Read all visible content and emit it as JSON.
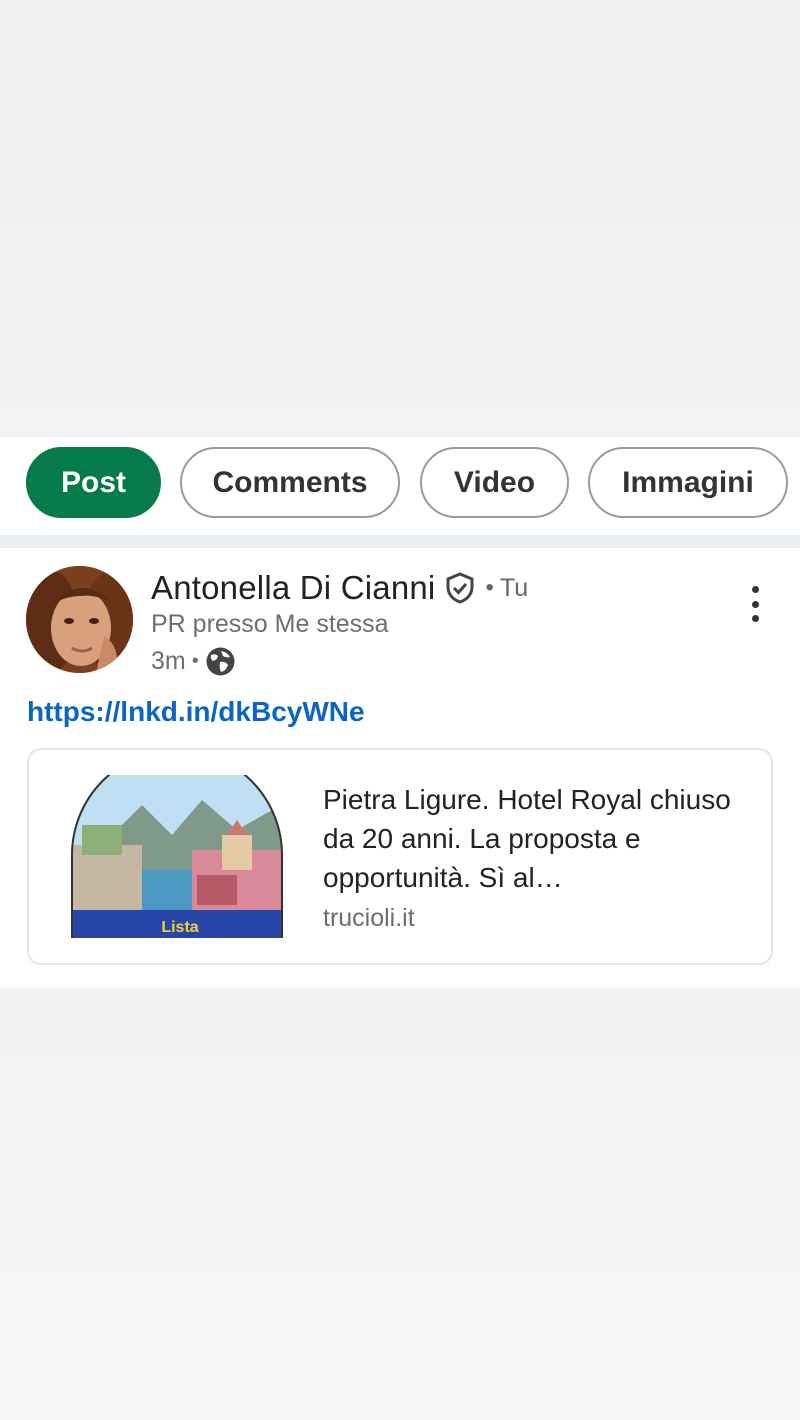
{
  "filter_tabs": {
    "post": "Post",
    "comments": "Comments",
    "video": "Video",
    "images": "Immagini",
    "active_color": "#067a4a"
  },
  "post": {
    "author_name": "Antonella Di Cianni",
    "you_label": "Tu",
    "headline": "PR presso Me stessa",
    "time": "3m",
    "visibility_icon": "globe-icon",
    "verified_icon": "verified-shield-icon",
    "link_text": "https://lnkd.in/dkBcyWNe",
    "link_color": "#0a66c2",
    "preview": {
      "title": "Pietra Ligure. Hotel Royal chiuso da 20 anni. La proposta e opportunità. Sì al…",
      "source": "trucioli.it",
      "thumbnail_caption": "Lista"
    }
  }
}
